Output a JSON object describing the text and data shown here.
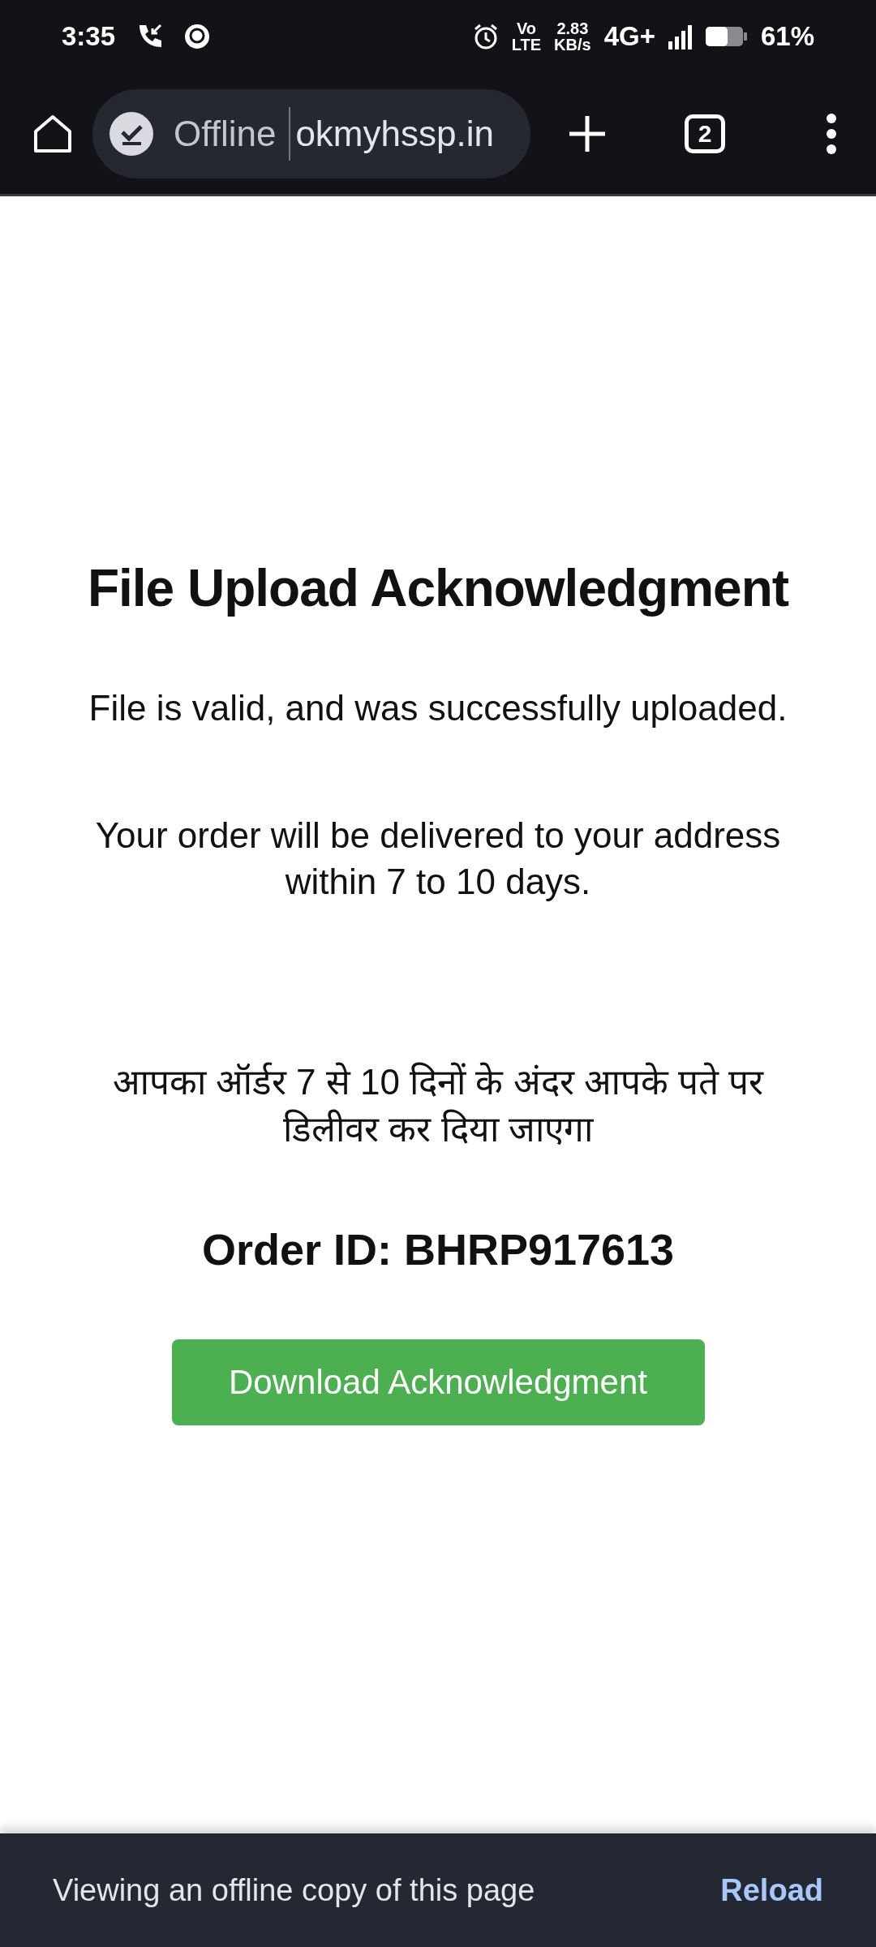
{
  "status_bar": {
    "time": "3:35",
    "volte": [
      "Vo",
      "LTE"
    ],
    "speed": [
      "2.83",
      "KB/s"
    ],
    "network": "4G+",
    "battery": "61%"
  },
  "toolbar": {
    "offline_label": "Offline",
    "url": "okmyhssp.in",
    "tab_count": "2"
  },
  "page": {
    "title": "File Upload Acknowledgment",
    "paragraphs": [
      "File is valid, and was successfully uploaded.",
      "Your order will be delivered to your address within 7 to 10 days.",
      "आपका ऑर्डर 7 से 10 दिनों के अंदर आपके पते पर डिलीवर कर दिया जाएगा"
    ],
    "order_id": "Order ID: BHRP917613",
    "button": "Download Acknowledgment"
  },
  "snackbar": {
    "message": "Viewing an offline copy of this page",
    "action": "Reload"
  }
}
